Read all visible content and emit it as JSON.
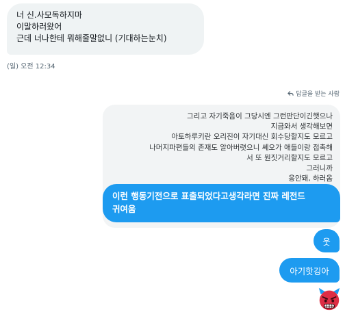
{
  "incoming_message": {
    "lines": [
      "너 신.사모독하지마",
      "이말하러왔어",
      "근데 너나한테 뭐해줄말없니 (기대하는눈치)"
    ],
    "timestamp": "(일) 오전 12:34"
  },
  "reply_header": {
    "label": "답글을 받는 사람",
    "icon": "reply-arrow-icon"
  },
  "quoted_message": {
    "lines": [
      "그리고 자기죽음이 그당시엔 그런판단이긴햇으나",
      "지금와서 생각해보면",
      "아토하루키란 오리진이 자기대신 회수당할지도 모르고",
      "나머지파편들의 존재도 알아버렷으니 쎄오가 애들이랑 접촉해",
      "서 또 뭔짓거리할지도 모르고",
      "그러니까",
      "응안돼, 하러옴"
    ]
  },
  "outgoing_messages": [
    {
      "lines": [
        "이런 행동기전으로 표출되었다고생각라면 진짜 레전드",
        "귀여움"
      ]
    },
    {
      "text": "웃"
    },
    {
      "text": "아기핫깅아"
    }
  ],
  "reaction": {
    "icon": "angry-devil-emoji-icon"
  },
  "colors": {
    "outgoing_bubble": "#1d9bf0",
    "incoming_bubble": "#eff3f4",
    "muted_text": "#536471"
  }
}
